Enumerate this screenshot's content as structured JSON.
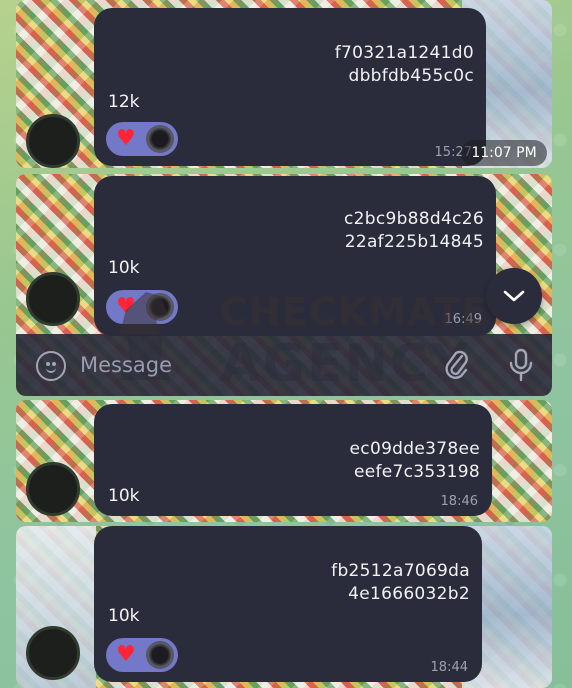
{
  "clock_overlay": "11:07 PM",
  "messages": [
    {
      "hash_line1": "f70321a1241d0",
      "hash_line2": "dbbfdb455c0c",
      "count": "12k",
      "time": "15:27",
      "reaction": "heart"
    },
    {
      "hash_line1": "c2bc9b88d4c26",
      "hash_line2": "22af225b14845",
      "count": "10k",
      "time": "16:49",
      "reaction": "heart"
    },
    {
      "hash_line1": "ec09dde378ee",
      "hash_line2": "eefe7c353198",
      "count": "10k",
      "time": "18:46",
      "reaction": ""
    },
    {
      "hash_line1": "fb2512a7069da",
      "hash_line2": "4e1666032b2",
      "count": "10k",
      "time": "18:44",
      "reaction": "heart"
    }
  ],
  "composer": {
    "placeholder": "Message"
  },
  "watermark": {
    "line1": "CHECKMATE",
    "line2": "AGENCY"
  },
  "colors": {
    "bubble": "#2b2c3b",
    "reaction_pill": "#7378c9",
    "heart": "#ff2436"
  }
}
